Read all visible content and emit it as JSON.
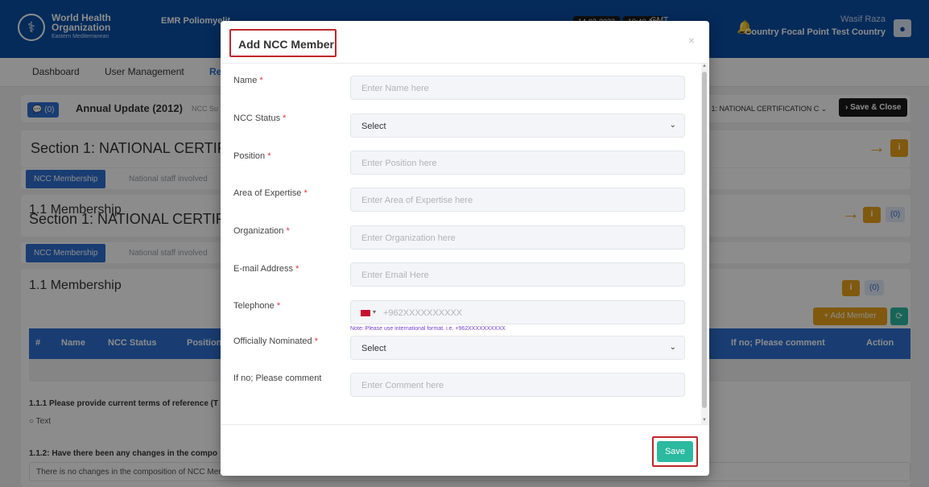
{
  "header": {
    "org_line1": "World Health",
    "org_line2": "Organization",
    "org_region": "Eastern Mediterranean",
    "app_title": "EMR Poliomyelit",
    "date": "14-03-2023",
    "time": "10:40 AM",
    "timezone": "GMT",
    "user_name": "Wasif Raza",
    "user_role": "Country Focal Point Test Country"
  },
  "nav": {
    "items": [
      "Dashboard",
      "User Management",
      "Rep"
    ]
  },
  "report_bar": {
    "comments_count": "(0)",
    "title": "Annual Update (2012)",
    "subtitle": "NCC Su",
    "section_select": "n 1: NATIONAL CERTIFICATION C",
    "save_close": "Save & Close"
  },
  "section": {
    "title": "Section 1: NATIONAL CERTIFI",
    "tabs": [
      "NCC Membership",
      "National staff involved"
    ],
    "membership_title": "1.1 Membership",
    "membership_overlap_title": "Section 1: NATIONAL CERTIFI",
    "comment_count": "(0)",
    "add_member": "Add Member"
  },
  "table": {
    "headers": [
      "#",
      "Name",
      "NCC Status",
      "Position",
      "If no; Please comment",
      "Action"
    ]
  },
  "questions": {
    "q1": "1.1.1 Please provide current terms of reference (T",
    "q1_option": "Text",
    "q2": "1.1.2: Have there been any changes in the compo",
    "q2_answer": "There is no changes in the composition of NCC Members"
  },
  "modal": {
    "title": "Add NCC Member",
    "close": "×",
    "fields": [
      {
        "label": "Name",
        "placeholder": "Enter Name here"
      },
      {
        "label": "NCC Status",
        "value": "Select"
      },
      {
        "label": "Position",
        "placeholder": "Enter Position here"
      },
      {
        "label": "Area of Expertise",
        "placeholder": "Enter Area of Expertise here"
      },
      {
        "label": "Organization",
        "placeholder": "Enter Organization here"
      },
      {
        "label": "E-mail Address",
        "placeholder": "Enter Email Here"
      },
      {
        "label": "Telephone",
        "placeholder": "+962XXXXXXXXXX",
        "note": "Note: Please use international format. i.e. +962XXXXXXXXXX"
      },
      {
        "label": "Officially Nominated",
        "value": "Select"
      },
      {
        "label": "If no; Please comment",
        "placeholder": "Enter Comment here"
      }
    ],
    "required_mark": "*",
    "save": "Save"
  },
  "colors": {
    "header_blue": "#0a4fa6",
    "primary_blue": "#2f6fd1",
    "accent_orange": "#e9a21a",
    "save_green": "#2bb9a0",
    "highlight_red": "#c0262c"
  }
}
